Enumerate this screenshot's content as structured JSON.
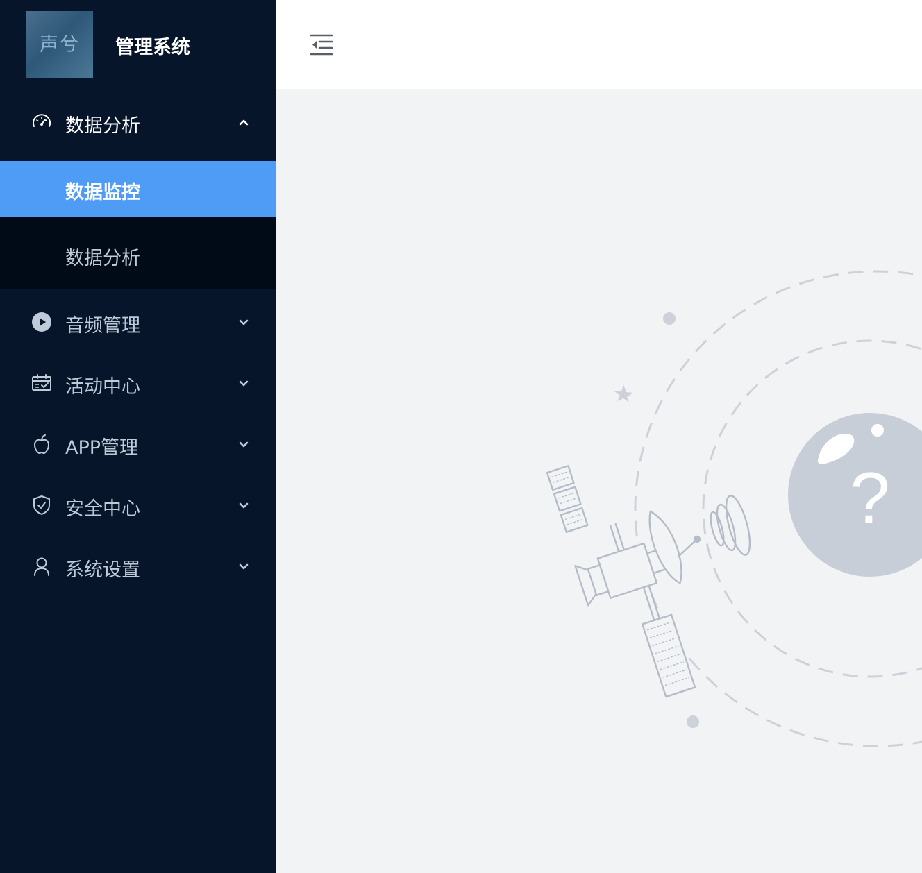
{
  "app": {
    "logo_text": "声兮",
    "title": "管理系统"
  },
  "colors": {
    "sidebar_bg": "#061529",
    "active_item_bg": "#4f9cf6",
    "submenu_bg": "#010b18",
    "content_bg": "#f2f3f5"
  },
  "sidebar": {
    "items": [
      {
        "label": "数据分析",
        "icon": "dashboard-icon",
        "expanded": true,
        "children": [
          {
            "label": "数据监控",
            "active": true
          },
          {
            "label": "数据分析",
            "active": false
          }
        ]
      },
      {
        "label": "音频管理",
        "icon": "play-circle-icon",
        "expanded": false
      },
      {
        "label": "活动中心",
        "icon": "calendar-icon",
        "expanded": false
      },
      {
        "label": "APP管理",
        "icon": "apple-icon",
        "expanded": false
      },
      {
        "label": "安全中心",
        "icon": "shield-icon",
        "expanded": false
      },
      {
        "label": "系统设置",
        "icon": "user-icon",
        "expanded": false
      }
    ]
  },
  "header": {
    "toggle_icon": "menu-fold-icon"
  },
  "main": {
    "illustration": "satellite-404-illustration",
    "glyph": "?"
  }
}
